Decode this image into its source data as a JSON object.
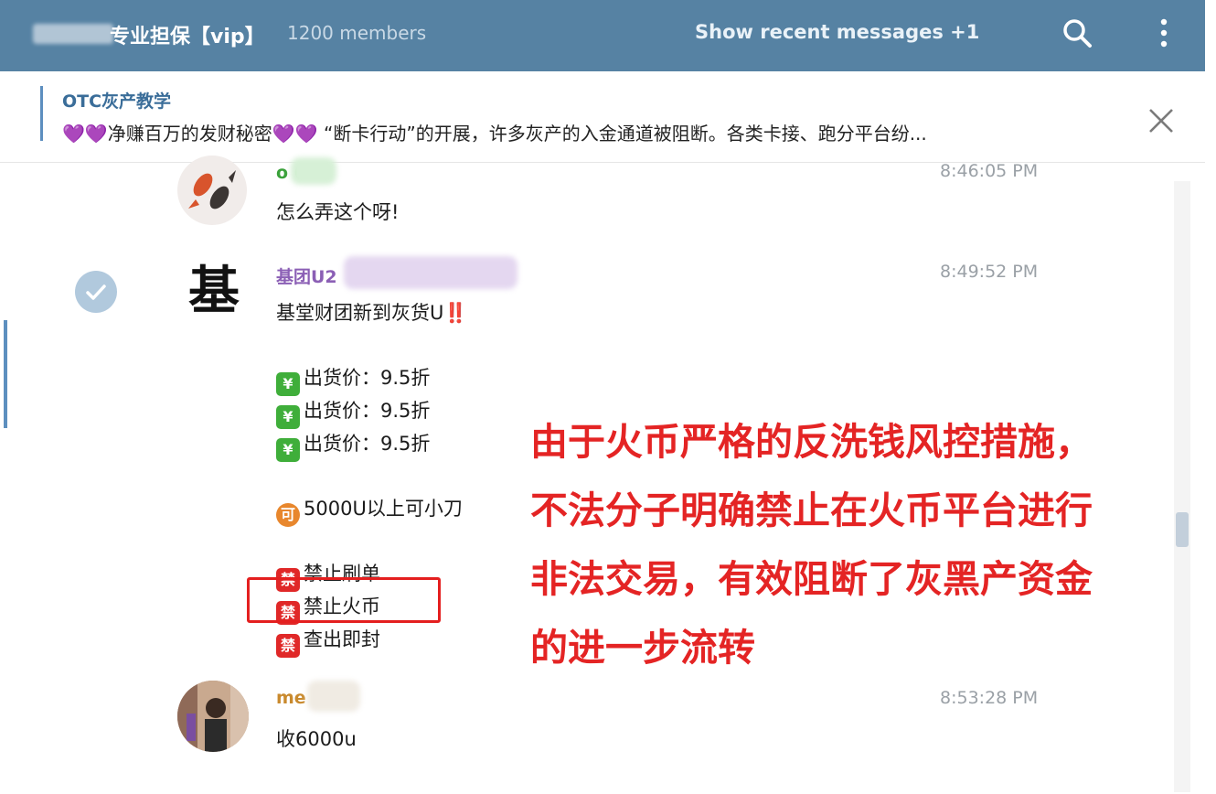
{
  "header": {
    "group_name": "专业担保【vip】",
    "members": "1200 members",
    "show_recent": "Show recent messages  +1",
    "icons": [
      "search-icon",
      "more-vertical-icon"
    ]
  },
  "pinned": {
    "title": "OTC灰产教学",
    "text": "💜💜净赚百万的发财秘密💜💜 “断卡行动”的开展，许多灰产的入金通道被阻断。各类卡接、跑分平台纷..."
  },
  "messages": [
    {
      "sender": "o    66",
      "sender_color": "#3aa13a",
      "time": "8:46:05 PM",
      "lines": [
        "怎么弄这个呀!"
      ]
    },
    {
      "sender": "基团U2",
      "sender_color": "#8b5fb5",
      "time": "8:49:52 PM",
      "avatar_text": "基",
      "lines": [
        "基堂财团新到灰货U‼️",
        "出货价：9.5折",
        "出货价：9.5折",
        "出货价：9.5折",
        "5000U以上可小刀",
        "禁止刷单",
        "禁止火币",
        "查出即封"
      ],
      "emoji_labels": [
        "¥",
        "可",
        "禁"
      ]
    },
    {
      "sender": "me",
      "sender_color": "#c98a2e",
      "time": "8:53:28 PM",
      "lines": [
        "收6000u"
      ]
    }
  ],
  "annotation": [
    "由于火币严格的反洗钱风控措施，",
    "不法分子明确禁止在火币平台进行",
    "非法交易，有效阻断了灰黑产资金",
    "的进一步流转"
  ],
  "colors": {
    "header_bg": "#5682a3",
    "annotation": "#e42424",
    "highlight_box": "#e41f1f"
  }
}
